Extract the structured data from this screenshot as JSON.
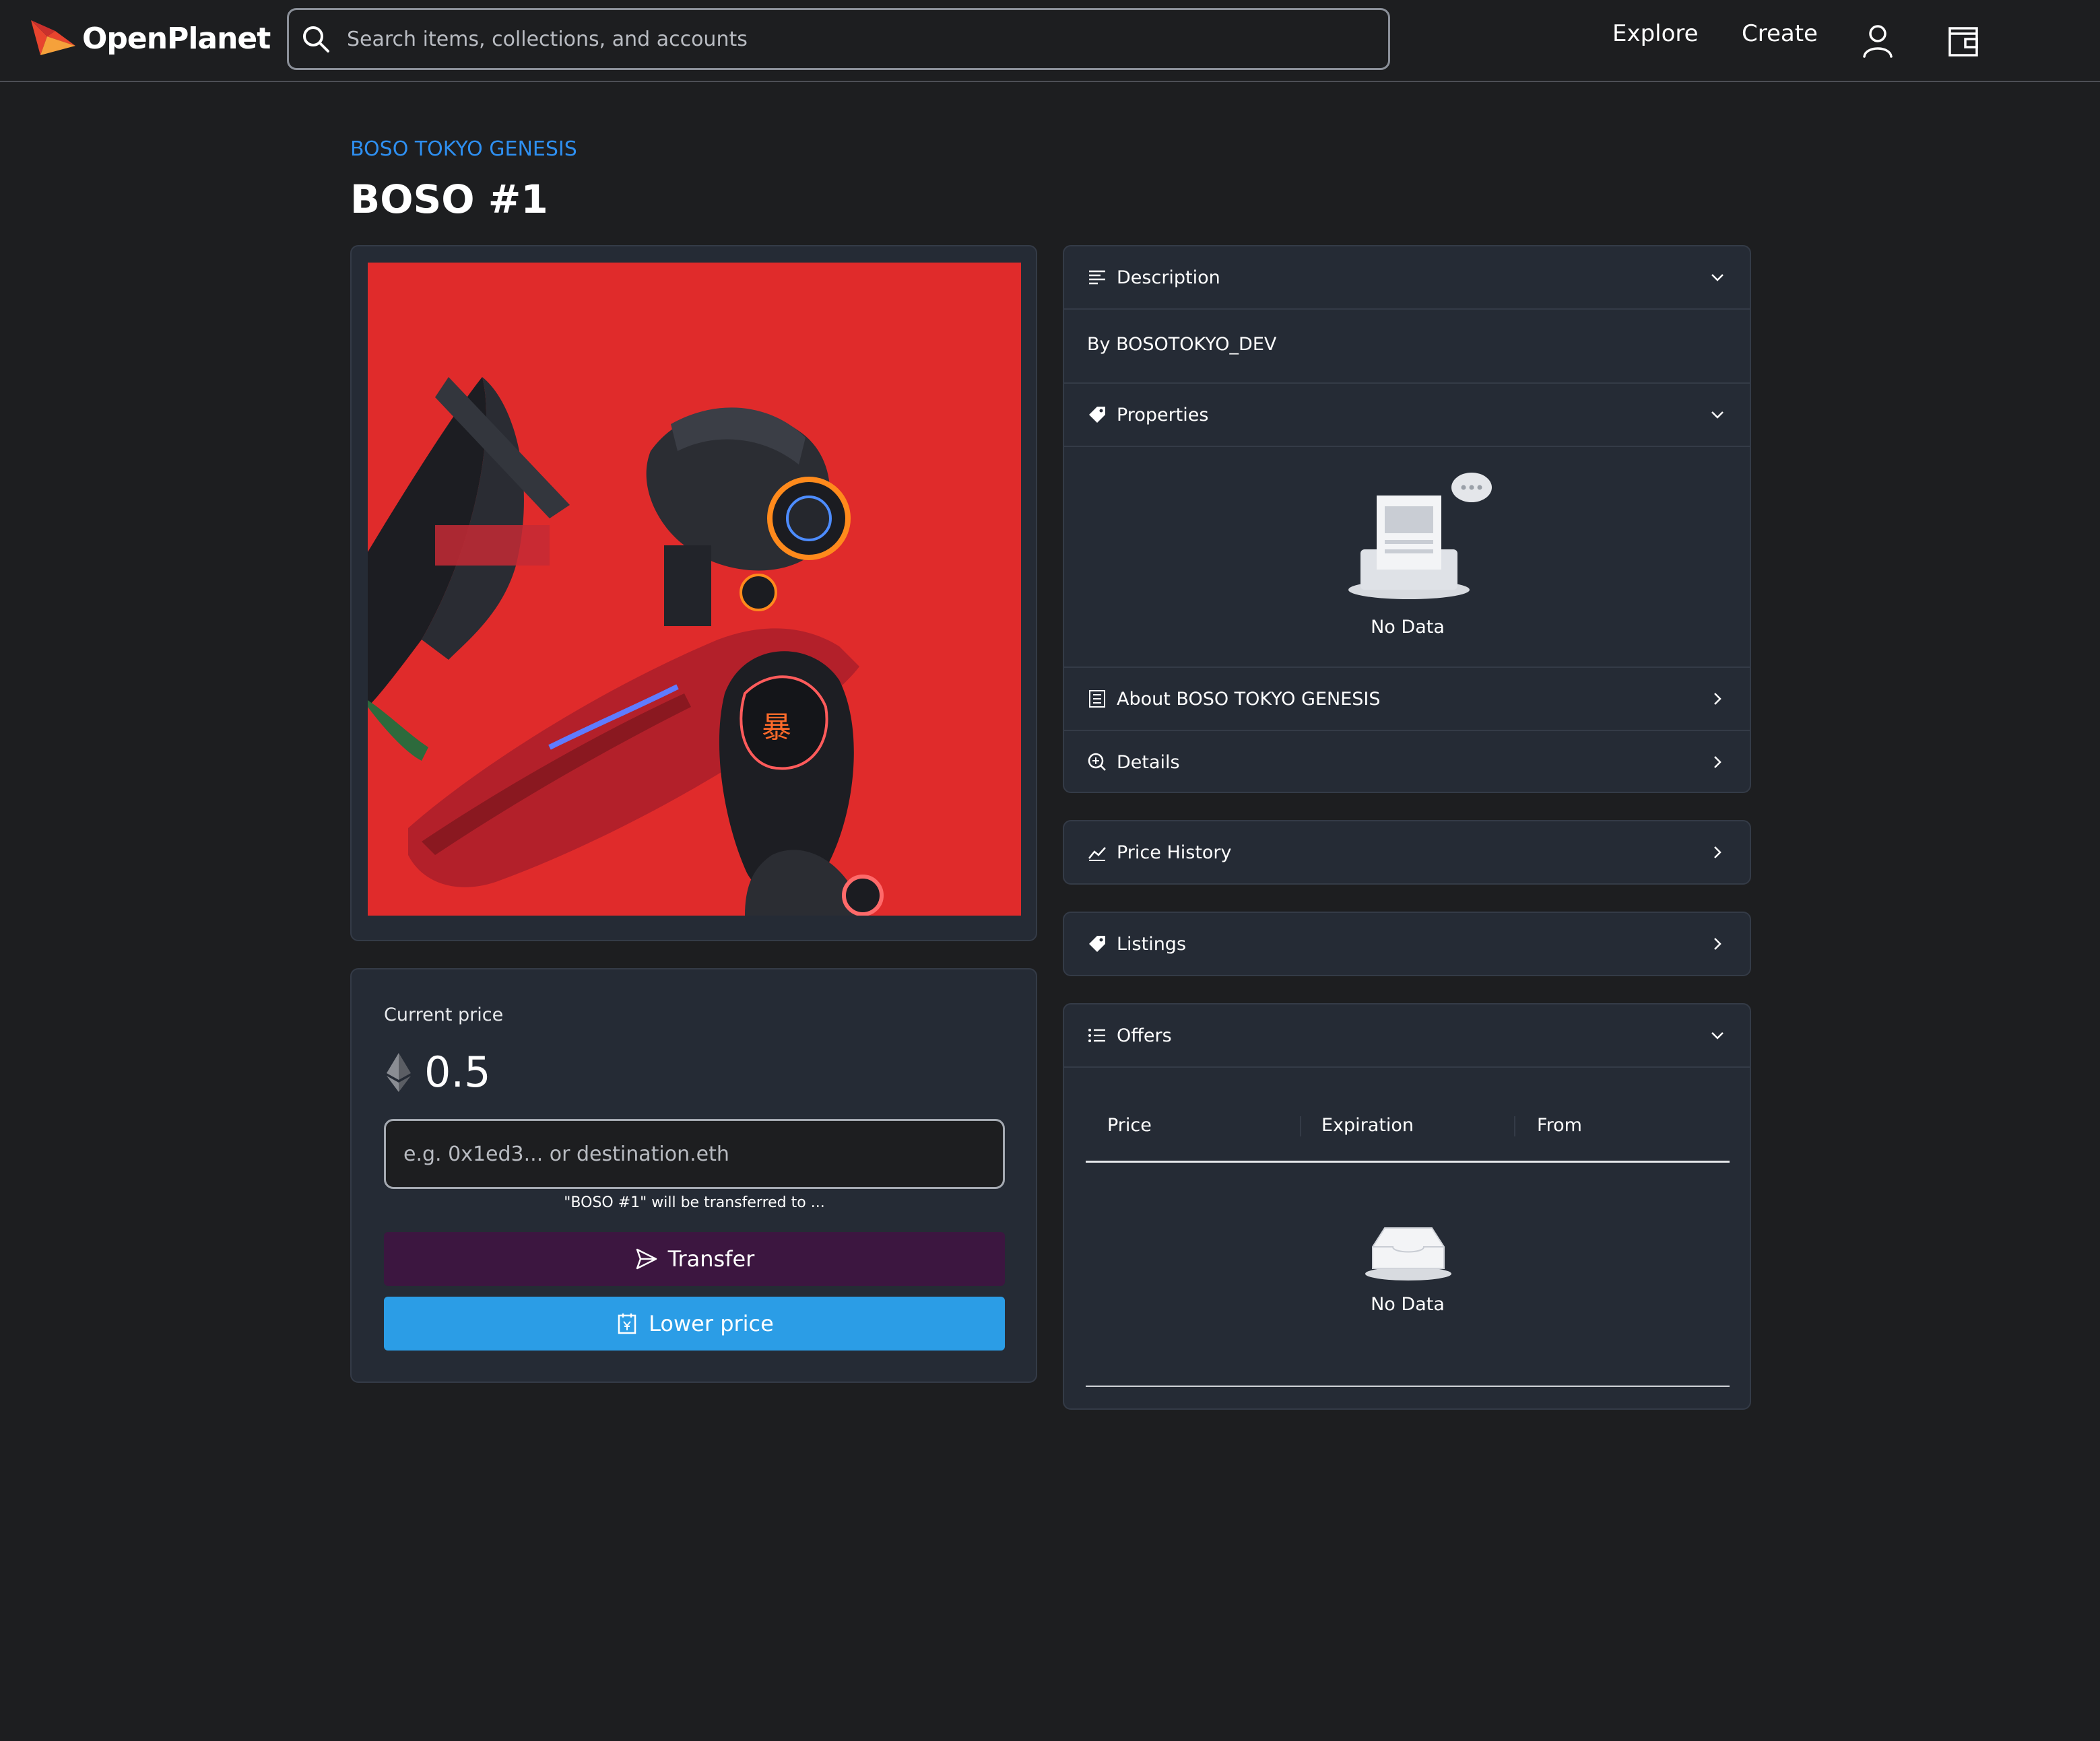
{
  "header": {
    "brand": "OpenPlanet",
    "search_placeholder": "Search items, collections, and accounts",
    "nav": {
      "explore": "Explore",
      "create": "Create"
    },
    "icons": [
      "search-icon",
      "user-icon",
      "wallet-icon"
    ]
  },
  "item": {
    "collection": "BOSO TOKYO GENESIS",
    "title": "BOSO #1"
  },
  "price_panel": {
    "label": "Current price",
    "currency_icon": "ethereum-icon",
    "value": "0.5",
    "address_placeholder": "e.g. 0x1ed3... or destination.eth",
    "transfer_note": "\"BOSO #1\" will be transferred to ...",
    "transfer_button": "Transfer",
    "lower_price_button": "Lower price"
  },
  "info_panel": {
    "description": {
      "label": "Description",
      "creator": "By BOSOTOKYO_DEV"
    },
    "properties": {
      "label": "Properties",
      "empty": "No Data"
    },
    "about": {
      "label": "About BOSO TOKYO GENESIS"
    },
    "details": {
      "label": "Details"
    }
  },
  "price_history": {
    "label": "Price History"
  },
  "listings": {
    "label": "Listings"
  },
  "offers": {
    "label": "Offers",
    "columns": [
      "Price",
      "Expiration",
      "From"
    ],
    "empty": "No Data"
  },
  "colors": {
    "background": "#1d1e20",
    "panel": "#252b35",
    "accent_blue": "#2b9de6",
    "link_blue": "#2e8ff0",
    "transfer_purple": "#3c1640",
    "art_red": "#e02b2b"
  }
}
